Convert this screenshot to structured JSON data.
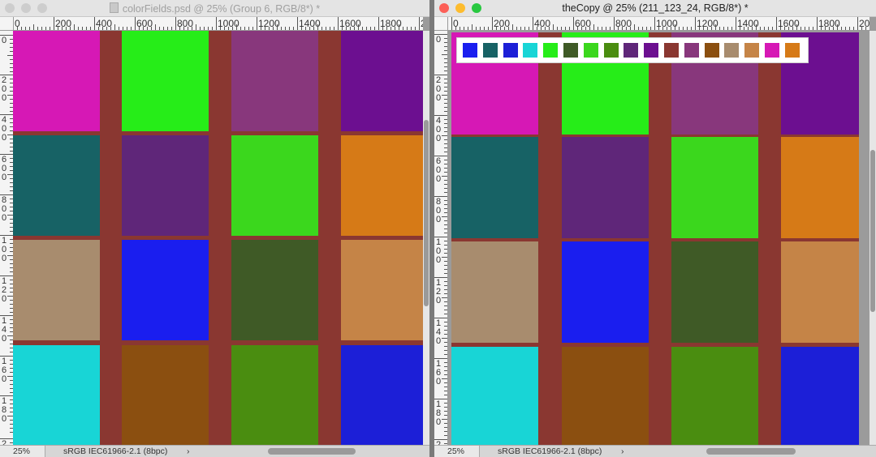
{
  "windows": [
    {
      "id": "win1",
      "title": "colorFields.psd @ 25% (Group 6, RGB/8*) *",
      "active": false,
      "ruler_top_labels": [
        "0",
        "200",
        "400",
        "600",
        "800",
        "1000",
        "1200",
        "1400",
        "1600",
        "1800",
        "20"
      ],
      "ruler_left_labels": [
        "0",
        "2\n0\n0",
        "4\n0\n0",
        "6\n0\n0",
        "8\n0\n0",
        "1\n0\n0",
        "1\n2\n0",
        "1\n4\n0",
        "1\n6\n0",
        "1\n8\n0",
        "2"
      ],
      "fields": [
        [
          "#d618b5",
          "#26ed18",
          "#88377c",
          "#6c0f90"
        ],
        [
          "#176265",
          "#5f2679",
          "#3bd71d",
          "#d67a17"
        ],
        [
          "#a88c6e",
          "#1a1eef",
          "#3f5a26",
          "#c58447"
        ],
        [
          "#18d5d6",
          "#8b4f10",
          "#4a8d10",
          "#1c1fd7"
        ]
      ],
      "status": {
        "zoom": "25%",
        "profile": "sRGB IEC61966-2.1 (8bpc)",
        "arrow": "›"
      }
    },
    {
      "id": "win2",
      "title": "theCopy @ 25% (211_123_24, RGB/8*) *",
      "active": true,
      "ruler_top_labels": [
        "0",
        "200",
        "400",
        "600",
        "800",
        "1000",
        "1200",
        "1400",
        "1600",
        "1800",
        "20"
      ],
      "ruler_left_labels": [
        "0",
        "2\n0\n0",
        "4\n0\n0",
        "6\n0\n0",
        "8\n0\n0",
        "1\n0\n0",
        "1\n2\n0",
        "1\n4\n0",
        "1\n6\n0",
        "1\n8\n0",
        "2"
      ],
      "fields": [
        [
          "#d618b5",
          "#26ed18",
          "#88377c",
          "#6c0f90"
        ],
        [
          "#176265",
          "#5f2679",
          "#3bd71d",
          "#d67a17"
        ],
        [
          "#a88c6e",
          "#1a1eef",
          "#3f5a26",
          "#c58447"
        ],
        [
          "#18d5d6",
          "#8b4f10",
          "#4a8d10",
          "#1c1fd7"
        ]
      ],
      "status": {
        "zoom": "25%",
        "profile": "sRGB IEC61966-2.1 (8bpc)",
        "arrow": "›"
      }
    }
  ],
  "traffic_lights": {
    "close": "#fc5f57",
    "minimize": "#fdbc2e",
    "maximize": "#28c840",
    "inactive": "#cdcdcd"
  },
  "background_color": "#8a3731",
  "palette_swatches": [
    "#1a1eef",
    "#176265",
    "#1c1fd7",
    "#18d5d6",
    "#26ed18",
    "#3f5a26",
    "#3bd71d",
    "#4a8d10",
    "#5f2679",
    "#6c0f90",
    "#8a3731",
    "#88377c",
    "#8b4f10",
    "#a88c6e",
    "#c58447",
    "#d618b5",
    "#d67a17"
  ]
}
